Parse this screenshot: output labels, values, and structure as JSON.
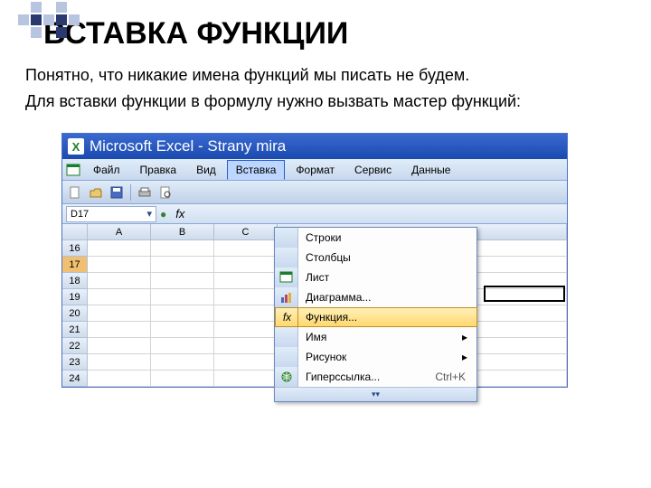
{
  "slide": {
    "title": "ВСТАВКА ФУНКЦИИ",
    "line1": "Понятно, что никакие имена функций мы писать не будем.",
    "line2": "Для вставки функции в формулу нужно вызвать мастер функций:"
  },
  "excel": {
    "titlebar": "Microsoft Excel - Strany mira",
    "menus": {
      "file": "Файл",
      "edit": "Правка",
      "view": "Вид",
      "insert": "Вставка",
      "format": "Формат",
      "tools": "Сервис",
      "data": "Данные"
    },
    "namebox": "D17",
    "fx_label": "fx",
    "columns": [
      "A",
      "B",
      "C"
    ],
    "rows": [
      "16",
      "17",
      "18",
      "19",
      "20",
      "21",
      "22",
      "23",
      "24"
    ],
    "selected_row": "17"
  },
  "insert_menu": {
    "rows": "Строки",
    "columns": "Столбцы",
    "sheet": "Лист",
    "chart": "Диаграмма...",
    "function": "Функция...",
    "name": "Имя",
    "picture": "Рисунок",
    "hyperlink": "Гиперссылка...",
    "hyperlink_shortcut": "Ctrl+K",
    "submenu_arrow": "▸"
  }
}
